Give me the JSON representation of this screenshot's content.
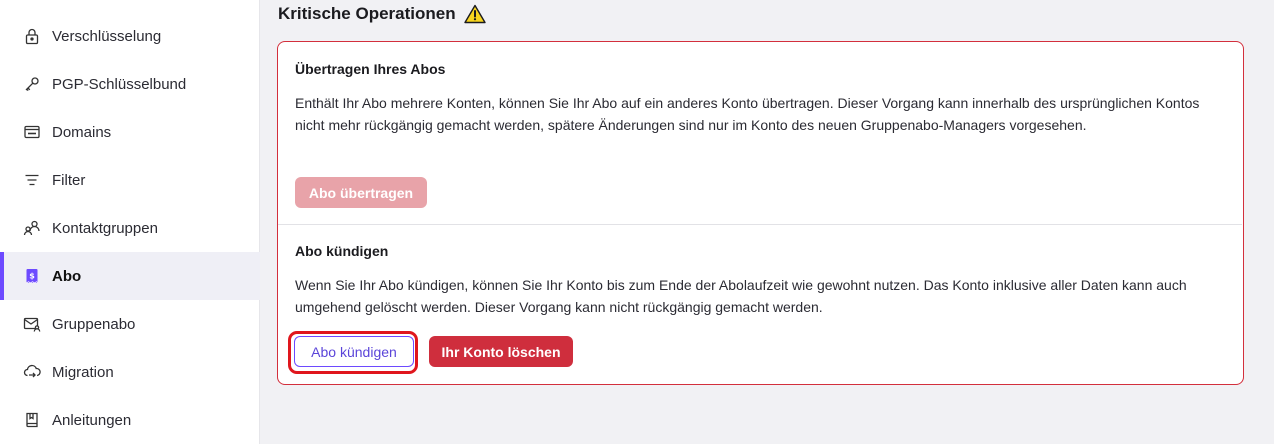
{
  "sidebar": {
    "items": [
      {
        "label": "Verschlüsselung",
        "icon": "lock-icon"
      },
      {
        "label": "PGP-Schlüsselbund",
        "icon": "key-icon"
      },
      {
        "label": "Domains",
        "icon": "domain-icon"
      },
      {
        "label": "Filter",
        "icon": "filter-icon"
      },
      {
        "label": "Kontaktgruppen",
        "icon": "contact-groups-icon"
      },
      {
        "label": "Abo",
        "icon": "subscription-icon",
        "active": true
      },
      {
        "label": "Gruppenabo",
        "icon": "envelope-user-icon"
      },
      {
        "label": "Migration",
        "icon": "cloud-migration-icon"
      },
      {
        "label": "Anleitungen",
        "icon": "book-icon"
      }
    ]
  },
  "main": {
    "title": "Kritische Operationen",
    "transfer": {
      "title": "Übertragen Ihres Abos",
      "text": "Enthält Ihr Abo mehrere Konten, können Sie Ihr Abo auf ein anderes Konto übertragen. Dieser Vorgang kann innerhalb des ursprünglichen Kontos nicht mehr rückgängig gemacht werden, spätere Änderungen sind nur im Konto des neuen Gruppenabo-Managers vorgesehen.",
      "button": "Abo übertragen"
    },
    "cancel": {
      "title": "Abo kündigen",
      "text": "Wenn Sie Ihr Abo kündigen, können Sie Ihr Konto bis zum Ende der Abolaufzeit wie gewohnt nutzen. Das Konto inklusive aller Daten kann auch umgehend gelöscht werden. Dieser Vorgang kann nicht rückgängig gemacht werden.",
      "cancel_button": "Abo kündigen",
      "delete_button": "Ihr Konto löschen"
    }
  },
  "colors": {
    "accent": "#6d4aff",
    "danger": "#cf2e3d",
    "danger_disabled": "#e8a3a9",
    "highlight": "#e0161d"
  }
}
